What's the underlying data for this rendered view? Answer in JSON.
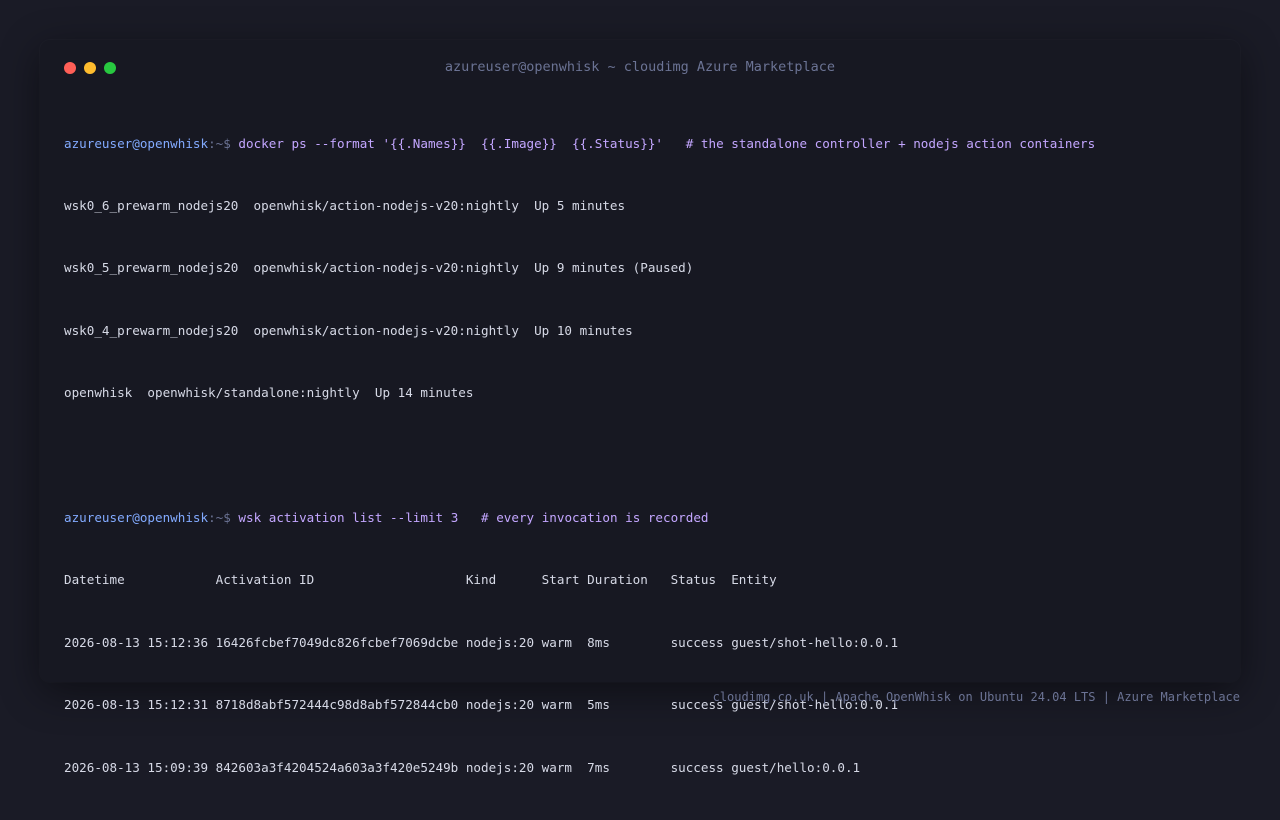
{
  "window": {
    "title": "azureuser@openwhisk ~ cloudimg Azure Marketplace"
  },
  "prompt": {
    "user_host": "azureuser@openwhisk",
    "path_symbol": ":~$"
  },
  "session": {
    "cmd1": {
      "command": "docker ps --format '{{.Names}}  {{.Image}}  {{.Status}}'",
      "comment": "# the standalone controller + nodejs action containers"
    },
    "docker_rows": [
      "wsk0_6_prewarm_nodejs20  openwhisk/action-nodejs-v20:nightly  Up 5 minutes",
      "wsk0_5_prewarm_nodejs20  openwhisk/action-nodejs-v20:nightly  Up 9 minutes (Paused)",
      "wsk0_4_prewarm_nodejs20  openwhisk/action-nodejs-v20:nightly  Up 10 minutes",
      "openwhisk  openwhisk/standalone:nightly  Up 14 minutes"
    ],
    "cmd2": {
      "command": "wsk activation list --limit 3",
      "comment": "# every invocation is recorded"
    },
    "activation_header": "Datetime            Activation ID                    Kind      Start Duration   Status  Entity",
    "activation_rows": [
      "2026-08-13 15:12:36 16426fcbef7049dc826fcbef7069dcbe nodejs:20 warm  8ms        success guest/shot-hello:0.0.1",
      "2026-08-13 15:12:31 8718d8abf572444c98d8abf572844cb0 nodejs:20 warm  5ms        success guest/shot-hello:0.0.1",
      "2026-08-13 15:09:39 842603a3f4204524a603a3f420e5249b nodejs:20 warm  7ms        success guest/hello:0.0.1"
    ]
  },
  "footer": {
    "text": "cloudimg.co.uk | Apache OpenWhisk on Ubuntu 24.04 LTS | Azure Marketplace"
  }
}
